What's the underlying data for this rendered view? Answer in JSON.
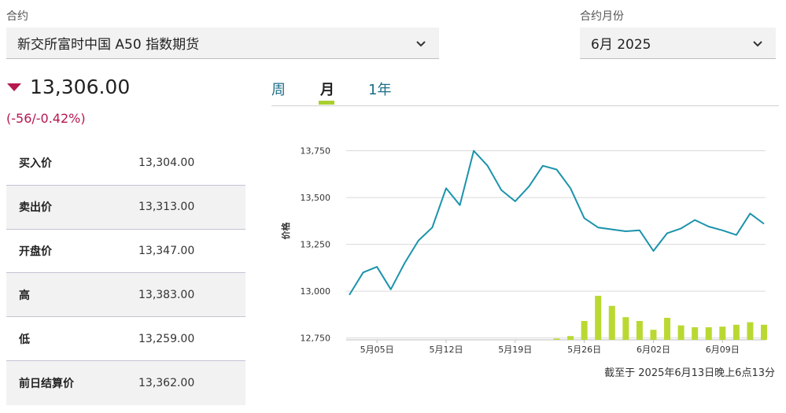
{
  "contract": {
    "label": "合约",
    "value": "新交所富时中国 A50 指数期货",
    "chevron_icon": "chevron-down-icon"
  },
  "contract_month": {
    "label": "合约月份",
    "value": "6月 2025",
    "chevron_icon": "chevron-down-icon"
  },
  "quote": {
    "direction_icon": "down-triangle-icon",
    "price": "13,306.00",
    "change": "(-56/-0.42%)",
    "down_color": "#b5174f",
    "rows": [
      {
        "label": "买入价",
        "value": "13,304.00"
      },
      {
        "label": "卖出价",
        "value": "13,313.00"
      },
      {
        "label": "开盘价",
        "value": "13,347.00"
      },
      {
        "label": "高",
        "value": "13,383.00"
      },
      {
        "label": "低",
        "value": "13,259.00"
      },
      {
        "label": "前日结算价",
        "value": "13,362.00"
      }
    ]
  },
  "tabs": [
    {
      "label": "周",
      "active": false
    },
    {
      "label": "月",
      "active": true
    },
    {
      "label": "1年",
      "active": false
    }
  ],
  "footnote": "截至于 2025年6月13日晚上6点13分",
  "colors": {
    "line": "#1b93ab",
    "bar": "#b9d932",
    "tab_accent": "#a8cf2f",
    "grid": "#d9d9d9",
    "link": "#1d6d86"
  },
  "chart_data": {
    "type": "line",
    "ylabel": "价格",
    "ylim": [
      12740,
      13820
    ],
    "yticks": [
      12750,
      13000,
      13250,
      13500,
      13750
    ],
    "ytick_labels": [
      "12,750",
      "13,000",
      "13,250",
      "13,500",
      "13,750"
    ],
    "xticks": [
      "5月05日",
      "5月12日",
      "5月19日",
      "5月26日",
      "6月02日",
      "6月09日"
    ],
    "grid": true,
    "series": [
      {
        "type": "line",
        "values": [
          12980,
          13100,
          13130,
          13010,
          13150,
          13270,
          13340,
          13550,
          13460,
          13750,
          13670,
          13540,
          13480,
          13560,
          13670,
          13650,
          13550,
          13390,
          13340,
          13330,
          13320,
          13325,
          13215,
          13310,
          13335,
          13380,
          13345,
          13325,
          13300,
          13415,
          13360
        ]
      },
      {
        "type": "volume-bar",
        "relative_heights": [
          0,
          0,
          0,
          0,
          0,
          0,
          0,
          0,
          0,
          0,
          0,
          0,
          0,
          0,
          0,
          0.02,
          0.06,
          0.3,
          0.7,
          0.54,
          0.36,
          0.3,
          0.16,
          0.35,
          0.23,
          0.2,
          0.2,
          0.21,
          0.24,
          0.28,
          0.24
        ]
      }
    ]
  }
}
